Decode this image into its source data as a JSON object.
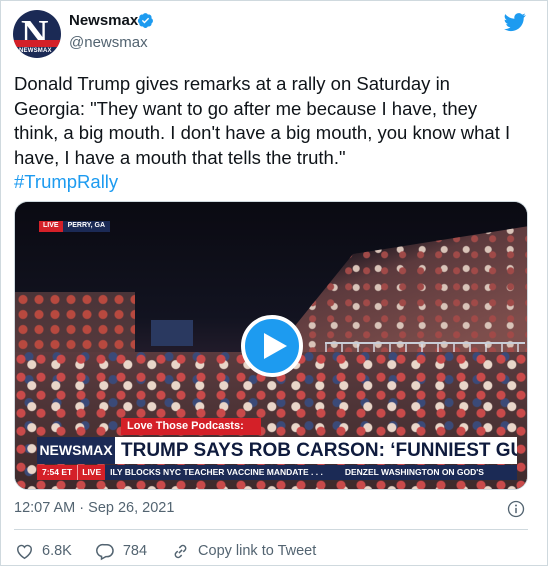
{
  "account": {
    "name": "Newsmax",
    "handle": "@newsmax",
    "avatar_letter": "N",
    "avatar_tag": "NEWSMAX"
  },
  "tweet": {
    "text": "Donald Trump gives remarks at a rally on Saturday in Georgia: \"They want to go after me because I have, they think, a big mouth. I don't have a big mouth, you know what I have, I have a mouth that tells the truth.\"",
    "hashtag": "#TrumpRally",
    "timestamp": "12:07 AM · Sep 26, 2021"
  },
  "media": {
    "live_label": "LIVE",
    "location": "PERRY, GA",
    "podcast_label": "Love Those Podcasts:",
    "brand": "NEWSMAX",
    "headline": "TRUMP SAYS ROB CARSON: ‘FUNNIEST GUY’",
    "ticker_time": "7:54 ET",
    "ticker_live": "LIVE",
    "ticker_item_1": "ILY BLOCKS NYC TEACHER VACCINE MANDATE . . .",
    "ticker_item_2": "DENZEL WASHINGTON ON GOD'S"
  },
  "actions": {
    "likes": "6.8K",
    "replies": "784",
    "copy_link": "Copy link to Tweet"
  },
  "colors": {
    "accent": "#1d9bf0",
    "brand_navy": "#1b2a55",
    "brand_red": "#d42028",
    "muted": "#536471"
  },
  "icons": [
    "verified-badge-icon",
    "twitter-bird-icon",
    "play-icon",
    "info-icon",
    "heart-icon",
    "reply-icon",
    "link-icon"
  ]
}
